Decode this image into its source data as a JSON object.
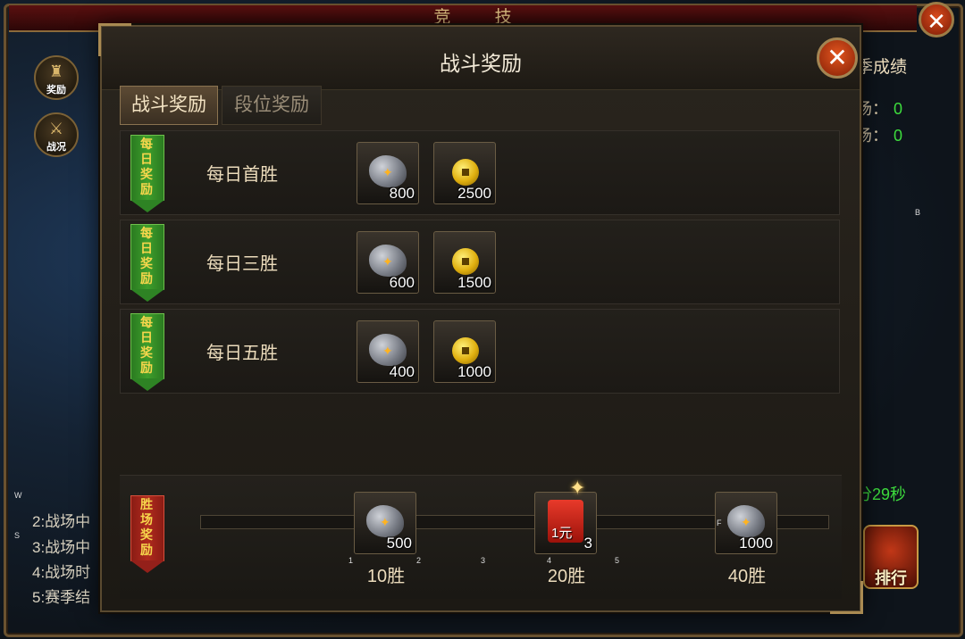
{
  "background": {
    "title": "竞 技",
    "close_glyph": "✕",
    "side_buttons": [
      {
        "label": "奖励",
        "icon": "reward-icon",
        "glyph": "♜"
      },
      {
        "label": "战况",
        "icon": "crossed-swords-icon",
        "glyph": "⚔"
      }
    ],
    "season_title": "季成绩",
    "stats": [
      {
        "label": "场：",
        "value": "0"
      },
      {
        "label": "场：",
        "value": "0"
      }
    ],
    "timer_text": "分29秒",
    "rank_label": "排行",
    "rules": [
      "2:战场中",
      "3:战场中",
      "4:战场时",
      "5:赛季结"
    ],
    "tiny_marks": [
      "B",
      "W",
      "S",
      "F",
      "1",
      "2",
      "3",
      "4",
      "5"
    ]
  },
  "modal": {
    "title": "战斗奖励",
    "close_glyph": "✕",
    "tabs": [
      {
        "label": "战斗奖励",
        "active": true
      },
      {
        "label": "段位奖励",
        "active": false
      }
    ],
    "banner_daily": [
      "每",
      "日",
      "奖",
      "励"
    ],
    "banner_win": [
      "胜",
      "场",
      "奖",
      "励"
    ],
    "rows": [
      {
        "label": "每日首胜",
        "ore": "800",
        "gold": "2500"
      },
      {
        "label": "每日三胜",
        "ore": "600",
        "gold": "1500"
      },
      {
        "label": "每日五胜",
        "ore": "400",
        "gold": "1000"
      }
    ],
    "milestones": [
      {
        "label": "10胜",
        "item": "ore",
        "count": "500"
      },
      {
        "label": "20胜",
        "item": "red-envelope",
        "item_text": "1元",
        "count": "3"
      },
      {
        "label": "40胜",
        "item": "ore",
        "count": "1000"
      }
    ],
    "colors": {
      "accent_green": "#3ddc3d",
      "banner_green": "#3e9e2c",
      "banner_red": "#b02a1e",
      "gold_text": "#f6d64c"
    }
  }
}
